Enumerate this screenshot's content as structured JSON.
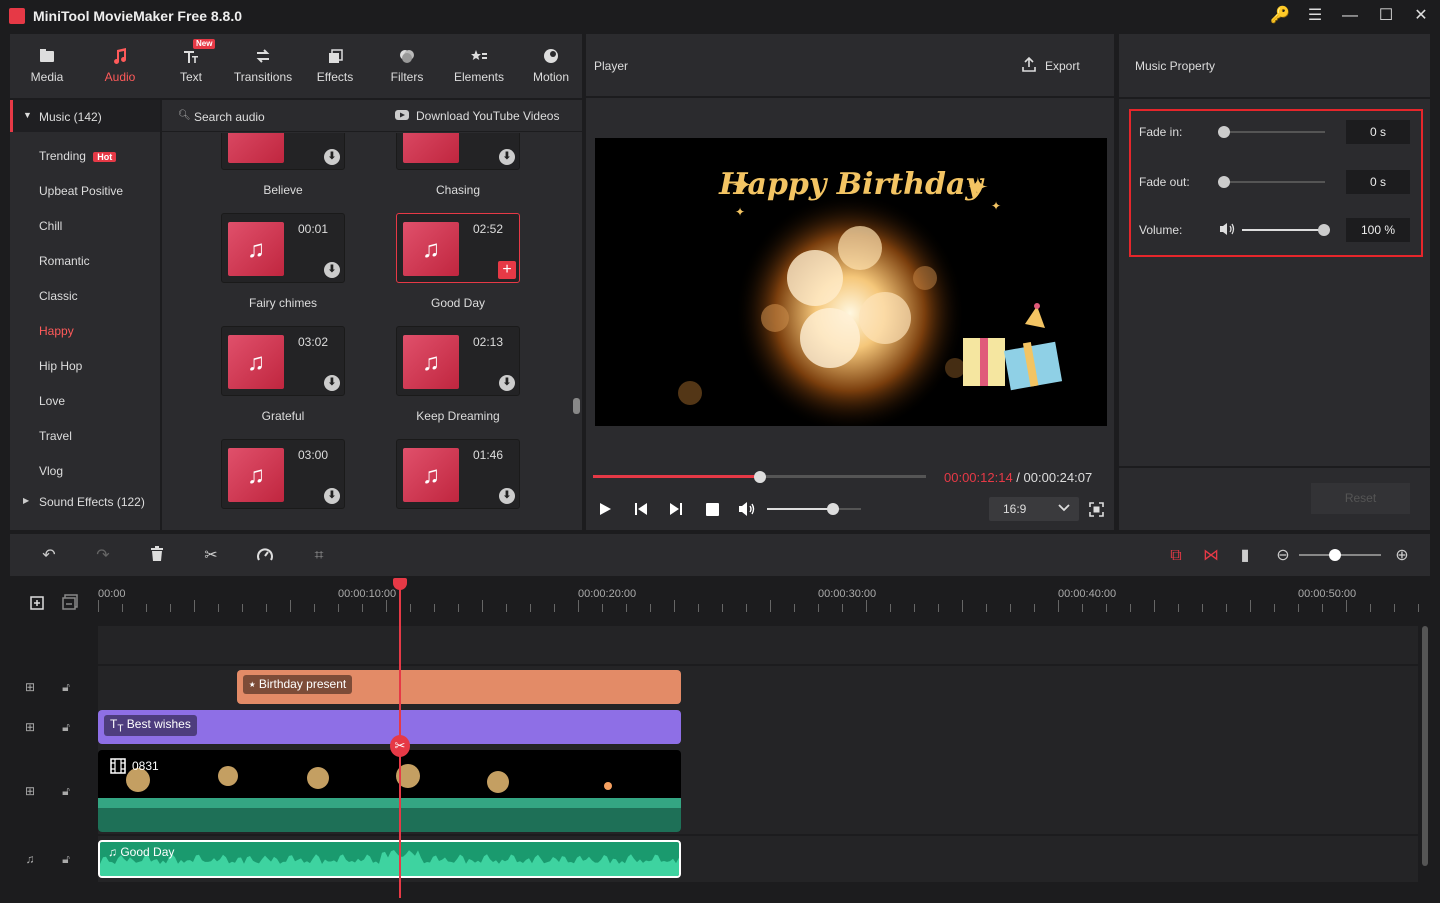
{
  "app": {
    "title": "MiniTool MovieMaker Free 8.8.0"
  },
  "window": {
    "key": "🔑",
    "menu": "☰",
    "minimize": "—",
    "maximize": "☐",
    "close": "✕"
  },
  "toolbar": {
    "tabs": [
      {
        "label": "Media",
        "icon": "media-icon"
      },
      {
        "label": "Audio",
        "icon": "audio-icon",
        "active": true
      },
      {
        "label": "Text",
        "icon": "text-icon",
        "badge": "New"
      },
      {
        "label": "Transitions",
        "icon": "transitions-icon"
      },
      {
        "label": "Effects",
        "icon": "effects-icon"
      },
      {
        "label": "Filters",
        "icon": "filters-icon"
      },
      {
        "label": "Elements",
        "icon": "elements-icon"
      },
      {
        "label": "Motion",
        "icon": "motion-icon"
      }
    ]
  },
  "sidebar": {
    "music_header": "Music (142)",
    "categories": [
      "Trending",
      "Upbeat Positive",
      "Chill",
      "Romantic",
      "Classic",
      "Happy",
      "Hip Hop",
      "Love",
      "Travel",
      "Vlog"
    ],
    "hot_badge": "Hot",
    "active_category": "Happy",
    "sound_effects": "Sound Effects (122)"
  },
  "library": {
    "search_placeholder": "Search audio",
    "download_youtube": "Download YouTube Videos",
    "items": [
      {
        "title": "Believe",
        "duration": ""
      },
      {
        "title": "Chasing",
        "duration": ""
      },
      {
        "title": "Fairy chimes",
        "duration": "00:01"
      },
      {
        "title": "Good Day",
        "duration": "02:52",
        "selected": true
      },
      {
        "title": "Grateful",
        "duration": "03:02"
      },
      {
        "title": "Keep Dreaming",
        "duration": "02:13"
      },
      {
        "title": "",
        "duration": "03:00"
      },
      {
        "title": "",
        "duration": "01:46"
      }
    ]
  },
  "player": {
    "title": "Player",
    "export": "Export",
    "video_title": "Happy Birthday",
    "current_time": "00:00:12:14",
    "separator": " / ",
    "total_time": "00:00:24:07",
    "progress": 0.5,
    "volume": 0.7,
    "aspect_ratio": "16:9"
  },
  "music_property": {
    "title": "Music Property",
    "fade_in_label": "Fade in:",
    "fade_in_value": "0 s",
    "fade_out_label": "Fade out:",
    "fade_out_value": "0 s",
    "volume_label": "Volume:",
    "volume_value": "100 %",
    "reset": "Reset"
  },
  "timeline": {
    "ruler": [
      "00:00",
      "00:00:10:00",
      "00:00:20:00",
      "00:00:30:00",
      "00:00:40:00",
      "00:00:50:00"
    ],
    "clips": {
      "element": "Birthday present",
      "text": "Best wishes",
      "video": "0831",
      "audio": "Good Day"
    }
  },
  "colors": {
    "accent": "#e63946",
    "element_clip": "#e38b67",
    "text_clip": "#8e6fe6",
    "audio_clip": "#2bb989",
    "video_strip": "#2a9d78"
  }
}
